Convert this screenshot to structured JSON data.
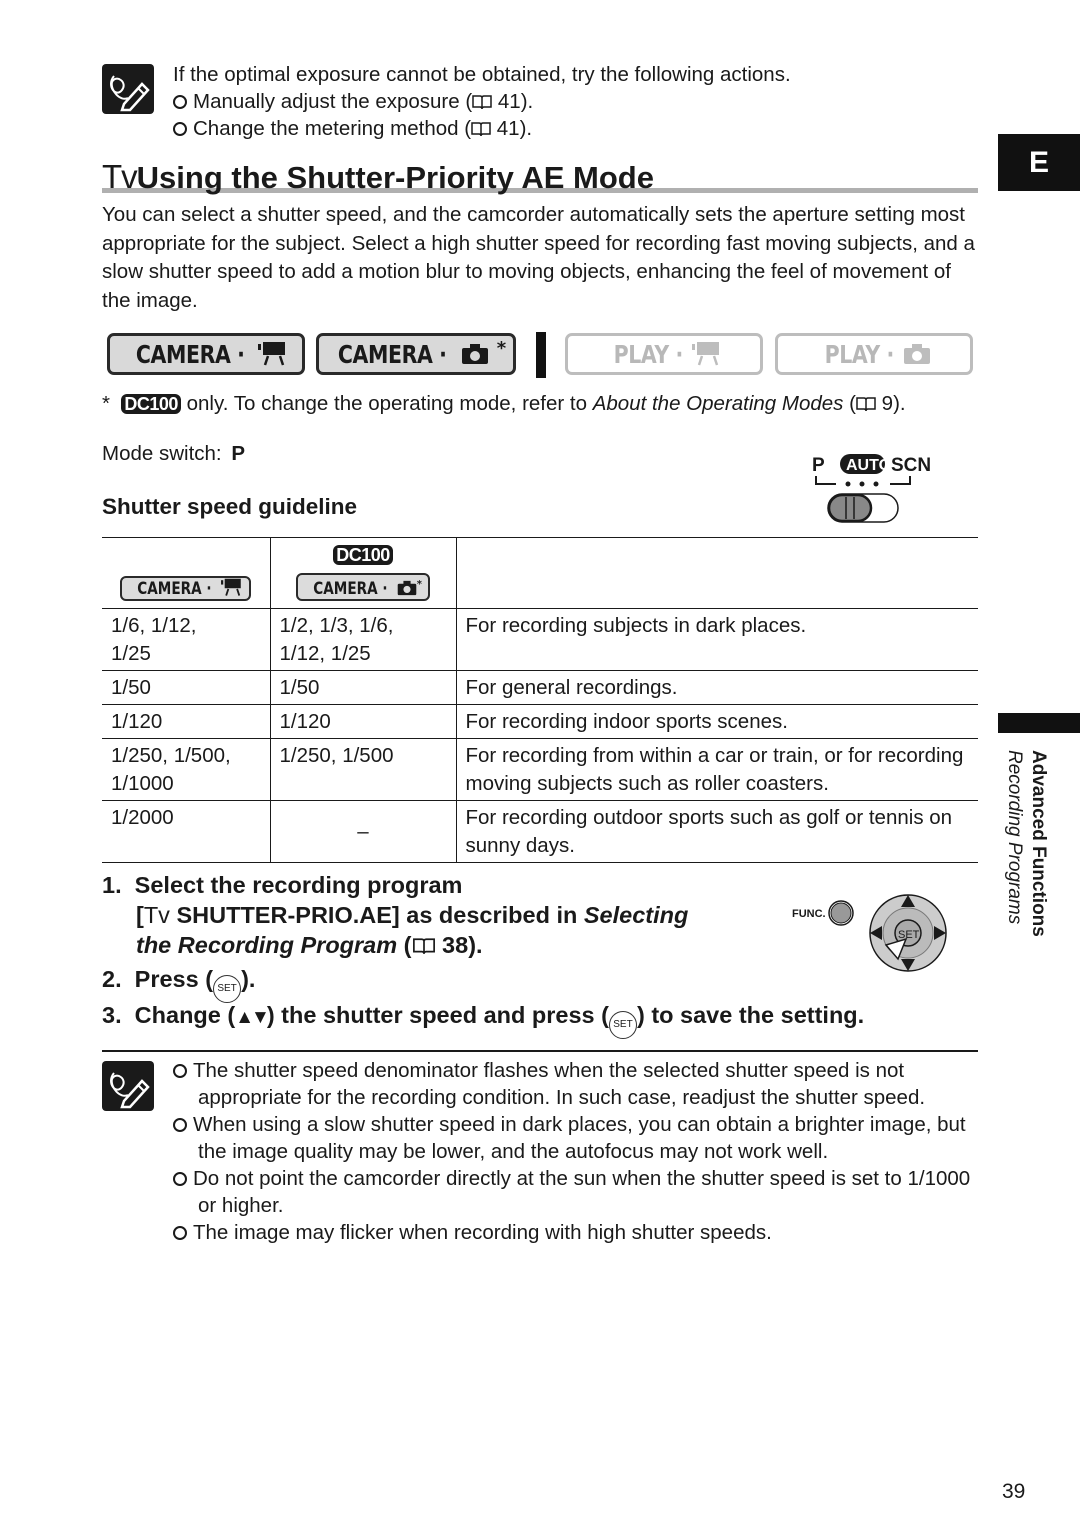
{
  "top_note": {
    "icon": "pencil-note-icon",
    "intro": "If the optimal exposure cannot be obtained, try the following actions.",
    "items": [
      {
        "text": "Manually adjust the exposure (",
        "page": "41",
        "tail": ")."
      },
      {
        "text": "Change the metering method (",
        "page": "41",
        "tail": ")."
      }
    ]
  },
  "section": {
    "tv_prefix": "Tv",
    "title": "Using the Shutter-Priority AE Mode",
    "paragraph": "You can select a shutter speed, and the camcorder automatically sets the aperture setting most appropriate for the subject. Select a high shutter speed for recording fast moving subjects, and a slow shutter speed to add a motion blur to moving objects, enhancing the feel of movement of the image."
  },
  "mode_buttons": [
    {
      "label": "CAMERA ·",
      "icon": "movie-camera-icon",
      "state": "active",
      "asterisk": ""
    },
    {
      "label": "CAMERA ·",
      "icon": "still-camera-icon",
      "state": "active",
      "asterisk": "*"
    },
    {
      "label": "PLAY ·",
      "icon": "movie-camera-icon",
      "state": "inactive",
      "asterisk": ""
    },
    {
      "label": "PLAY ·",
      "icon": "still-camera-icon",
      "state": "inactive",
      "asterisk": ""
    }
  ],
  "footnote": {
    "star": "*",
    "badge": "DC100",
    "text_before": " only. To change the operating mode, refer to ",
    "link_italic": "About the Operating Modes",
    "text_after_open": " (",
    "page": "9",
    "text_close": ")."
  },
  "mode_switch": {
    "label": "Mode switch:",
    "value": "P",
    "diagram": {
      "p": "P",
      "auto": "AUTO",
      "scn": "SCN"
    }
  },
  "guideline": {
    "heading": "Shutter speed guideline",
    "header": {
      "col1_btn": "CAMERA ·",
      "col2_badge": "DC100",
      "col2_btn": "CAMERA ·",
      "col2_asterisk": "*"
    },
    "rows": [
      {
        "movie": "1/6, 1/12, 1/25",
        "still": "1/2, 1/3, 1/6, 1/12, 1/25",
        "desc": "For recording subjects in dark places."
      },
      {
        "movie": "1/50",
        "still": "1/50",
        "desc": "For general recordings."
      },
      {
        "movie": "1/120",
        "still": "1/120",
        "desc": "For recording indoor sports scenes."
      },
      {
        "movie": "1/250, 1/500, 1/1000",
        "still": "1/250, 1/500",
        "desc": "For recording from within a car or train, or for recording moving subjects such as roller coasters."
      },
      {
        "movie": "1/2000",
        "still": "–",
        "desc": "For recording outdoor sports such as golf or tennis on sunny days."
      }
    ]
  },
  "steps": {
    "s1_num": "1.",
    "s1_title": "Select the recording program",
    "s1_bracket_open": "[",
    "s1_tv": "Tv",
    "s1_prog": " SHUTTER-PRIO.AE]",
    "s1_as": " as described in ",
    "s1_ref_italic_1": "Selecting",
    "s1_ref_italic_2": "the Recording Program",
    "s1_page_open": " (",
    "s1_page": "38",
    "s1_close": ").",
    "s2_num": "2.",
    "s2_text": "Press (",
    "s2_close": ").",
    "s3_num": "3.",
    "s3_text_a": "Change (",
    "s3_arrows": "▲▼",
    "s3_text_b": ") the shutter speed and press (",
    "s3_text_c": ") to save the setting.",
    "set_label": "SET",
    "func_label": "FUNC."
  },
  "bottom_notes": {
    "icon": "pencil-note-icon",
    "items": [
      "The shutter speed denominator flashes when the selected shutter speed is not appropriate for the recording condition. In such case, readjust the shutter speed.",
      "When using a slow shutter speed in dark places, you can obtain a brighter image, but the image quality may be lower, and the autofocus may not work well.",
      "Do not point the camcorder directly at the sun when the shutter speed is set to 1/1000 or higher.",
      "The image may flicker when recording with high shutter speeds."
    ]
  },
  "side": {
    "language_tab": "E",
    "chapter": "Advanced Functions",
    "subchapter": "Recording Programs"
  },
  "page_number": "39"
}
